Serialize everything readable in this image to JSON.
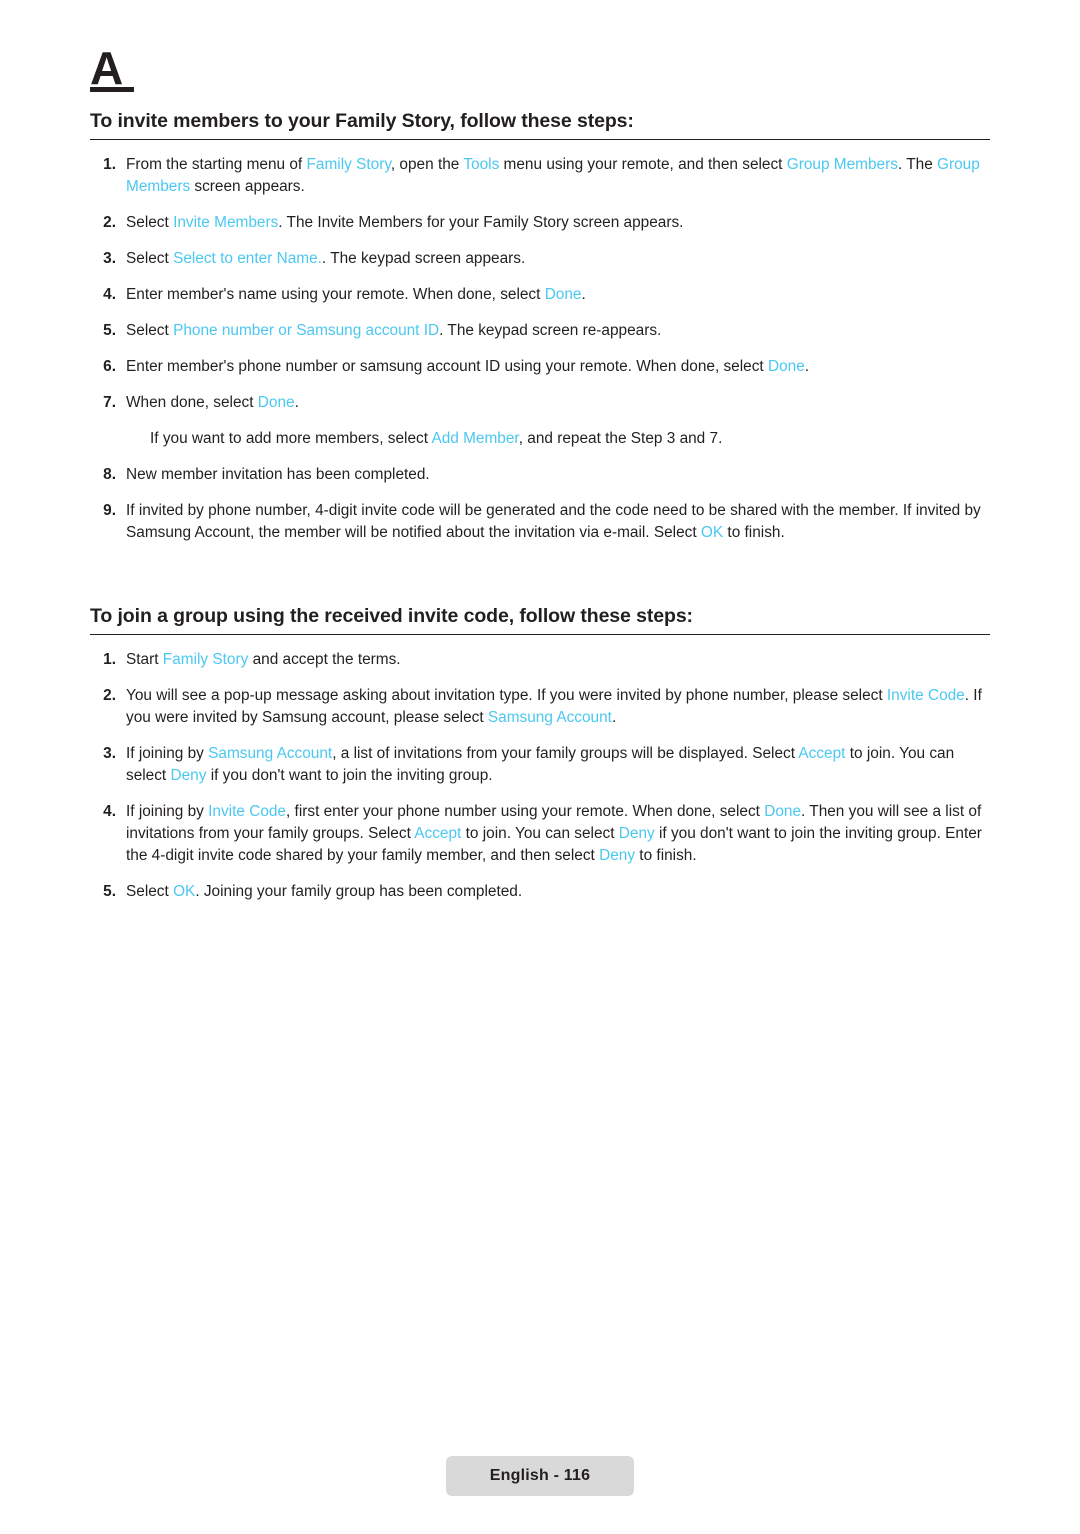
{
  "logo": {
    "text": "A"
  },
  "section1": {
    "title": "To invite members to your Family Story, follow these steps:",
    "steps": [
      {
        "num": "1.",
        "parts": [
          {
            "t": "From the starting menu of ",
            "hl": false
          },
          {
            "t": "Family Story",
            "hl": true
          },
          {
            "t": ", open the ",
            "hl": false
          },
          {
            "t": "Tools",
            "hl": true
          },
          {
            "t": " menu using your remote, and then select ",
            "hl": false
          },
          {
            "t": "Group Members",
            "hl": true
          },
          {
            "t": ". The ",
            "hl": false
          },
          {
            "t": "Group Members",
            "hl": true
          },
          {
            "t": " screen appears.",
            "hl": false
          }
        ]
      },
      {
        "num": "2.",
        "parts": [
          {
            "t": "Select ",
            "hl": false
          },
          {
            "t": "Invite Members",
            "hl": true
          },
          {
            "t": ". The Invite Members for your Family Story screen appears.",
            "hl": false
          }
        ]
      },
      {
        "num": "3.",
        "parts": [
          {
            "t": "Select ",
            "hl": false
          },
          {
            "t": "Select to enter Name.",
            "hl": true
          },
          {
            "t": ". The keypad screen appears.",
            "hl": false
          }
        ]
      },
      {
        "num": "4.",
        "parts": [
          {
            "t": "Enter member's name using your remote. When done, select ",
            "hl": false
          },
          {
            "t": "Done",
            "hl": true
          },
          {
            "t": ".",
            "hl": false
          }
        ]
      },
      {
        "num": "5.",
        "parts": [
          {
            "t": "Select ",
            "hl": false
          },
          {
            "t": "Phone number or Samsung account ID",
            "hl": true
          },
          {
            "t": ". The keypad screen re-appears.",
            "hl": false
          }
        ]
      },
      {
        "num": "6.",
        "parts": [
          {
            "t": "Enter member's phone number or samsung account ID using your remote. When done, select ",
            "hl": false
          },
          {
            "t": "Done",
            "hl": true
          },
          {
            "t": ".",
            "hl": false
          }
        ]
      },
      {
        "num": "7.",
        "parts": [
          {
            "t": "When done, select ",
            "hl": false
          },
          {
            "t": "Done",
            "hl": true
          },
          {
            "t": ".",
            "hl": false
          }
        ]
      }
    ],
    "note": [
      {
        "t": "If you want to add more members, select ",
        "hl": false
      },
      {
        "t": "Add Member",
        "hl": true
      },
      {
        "t": ", and repeat the Step 3 and 7.",
        "hl": false
      }
    ],
    "steps_after_note": [
      {
        "num": "8.",
        "parts": [
          {
            "t": "New member invitation has been completed.",
            "hl": false
          }
        ]
      },
      {
        "num": "9.",
        "parts": [
          {
            "t": "If invited by phone number, 4-digit invite code will be generated and the code need to be shared with the member. If invited by Samsung Account, the member will be notified about the invitation via e-mail. Select ",
            "hl": false
          },
          {
            "t": "OK",
            "hl": true
          },
          {
            "t": " to finish.",
            "hl": false
          }
        ]
      }
    ]
  },
  "section2": {
    "title": "To join a group using the received invite code, follow these steps:",
    "steps": [
      {
        "num": "1.",
        "parts": [
          {
            "t": "Start ",
            "hl": false
          },
          {
            "t": "Family Story",
            "hl": true
          },
          {
            "t": " and accept the terms.",
            "hl": false
          }
        ]
      },
      {
        "num": "2.",
        "parts": [
          {
            "t": "You will see a pop-up message asking about invitation type. If you were invited by phone number, please select ",
            "hl": false
          },
          {
            "t": "Invite Code",
            "hl": true
          },
          {
            "t": ". If you were invited by Samsung account, please select ",
            "hl": false
          },
          {
            "t": "Samsung Account",
            "hl": true
          },
          {
            "t": ".",
            "hl": false
          }
        ]
      },
      {
        "num": "3.",
        "parts": [
          {
            "t": "If joining by ",
            "hl": false
          },
          {
            "t": "Samsung Account",
            "hl": true
          },
          {
            "t": ", a list of invitations from your family groups will be displayed. Select ",
            "hl": false
          },
          {
            "t": "Accept",
            "hl": true
          },
          {
            "t": " to join. You can select ",
            "hl": false
          },
          {
            "t": "Deny",
            "hl": true
          },
          {
            "t": " if you don't want to join the inviting group.",
            "hl": false
          }
        ]
      },
      {
        "num": "4.",
        "parts": [
          {
            "t": "If joining by ",
            "hl": false
          },
          {
            "t": "Invite Code",
            "hl": true
          },
          {
            "t": ", first enter your phone number using your remote. When done, select ",
            "hl": false
          },
          {
            "t": "Done",
            "hl": true
          },
          {
            "t": ". Then you will see a list of invitations from your family groups. Select ",
            "hl": false
          },
          {
            "t": "Accept",
            "hl": true
          },
          {
            "t": " to join. You can select ",
            "hl": false
          },
          {
            "t": "Deny",
            "hl": true
          },
          {
            "t": " if you don't want to join the inviting group. Enter the 4-digit invite code shared by your family member, and then select ",
            "hl": false
          },
          {
            "t": "Deny",
            "hl": true
          },
          {
            "t": " to finish.",
            "hl": false
          }
        ]
      },
      {
        "num": "5.",
        "parts": [
          {
            "t": "Select ",
            "hl": false
          },
          {
            "t": "OK",
            "hl": true
          },
          {
            "t": ". Joining your family group has been completed.",
            "hl": false
          }
        ]
      }
    ]
  },
  "footer": {
    "label": "English - 116"
  },
  "colors": {
    "highlight": "#4bc8f0",
    "text": "#231f20",
    "footer_bg": "#d9d9d9"
  }
}
